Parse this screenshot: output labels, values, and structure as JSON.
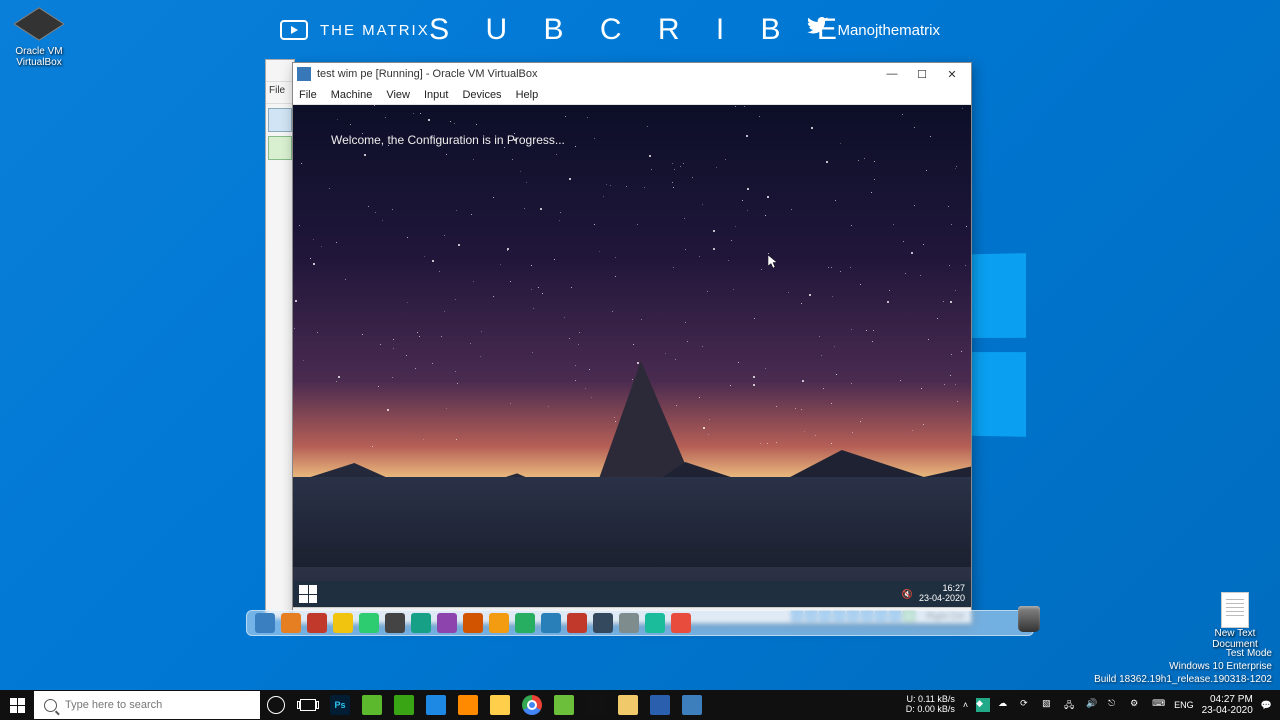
{
  "banner": {
    "youtube_label": "THE MATRIX",
    "subscribe": "S U B C R I B E",
    "twitter_handle": "Manojthematrix"
  },
  "desktop": {
    "vbox_icon_label": "Oracle VM\nVirtualBox",
    "newtext_label": "New Text\nDocument"
  },
  "watermark": {
    "line1": "Test Mode",
    "line2": "Windows 10 Enterprise",
    "line3": "Build 18362.19h1_release.190318-1202"
  },
  "vm": {
    "title": "test wim pe [Running] - Oracle VM VirtualBox",
    "menu": [
      "File",
      "Machine",
      "View",
      "Input",
      "Devices",
      "Help"
    ],
    "welcome": "Welcome, the Configuration is in Progress...",
    "inner_time": "16:27",
    "inner_date": "23-04-2020",
    "hostkey": "Right Ctrl",
    "win_min": "—",
    "win_max": "☐",
    "win_close": "✕"
  },
  "vbox_mgr": {
    "file_label": "File"
  },
  "taskbar": {
    "search_placeholder": "Type here to search",
    "net_up_label": "U:",
    "net_up": "0.11 kB/s",
    "net_down_label": "D:",
    "net_down": "0.00 kB/s",
    "lang": "ENG",
    "time": "04:27 PM",
    "date": "23-04-2020"
  },
  "dock_colors": [
    "#3a7fbf",
    "#e67e22",
    "#c0392b",
    "#f1c40f",
    "#2ecc71",
    "#444",
    "#16a085",
    "#8e44ad",
    "#d35400",
    "#f39c12",
    "#27ae60",
    "#2980b9",
    "#c0392b",
    "#34495e",
    "#7f8c8d",
    "#1abc9c",
    "#e74c3c"
  ],
  "taskbar_apps": [
    {
      "name": "photoshop",
      "bg": "#001d34",
      "txt": "Ps",
      "col": "#31c5f0"
    },
    {
      "name": "camtasia-green",
      "bg": "#5cb82c"
    },
    {
      "name": "utorrent",
      "bg": "#3aa514"
    },
    {
      "name": "edge",
      "bg": "#1e88e5"
    },
    {
      "name": "everything",
      "bg": "#ff8a00"
    },
    {
      "name": "explorer",
      "bg": "#ffcf4b"
    },
    {
      "name": "chrome",
      "bg": "#fff"
    },
    {
      "name": "camtasia",
      "bg": "#6bbf3b"
    },
    {
      "name": "cmd",
      "bg": "#111"
    },
    {
      "name": "paint",
      "bg": "#f0c96a"
    },
    {
      "name": "virtualbox",
      "bg": "#2a5fae"
    },
    {
      "name": "vbox-vm",
      "bg": "#3d7ebd"
    }
  ]
}
